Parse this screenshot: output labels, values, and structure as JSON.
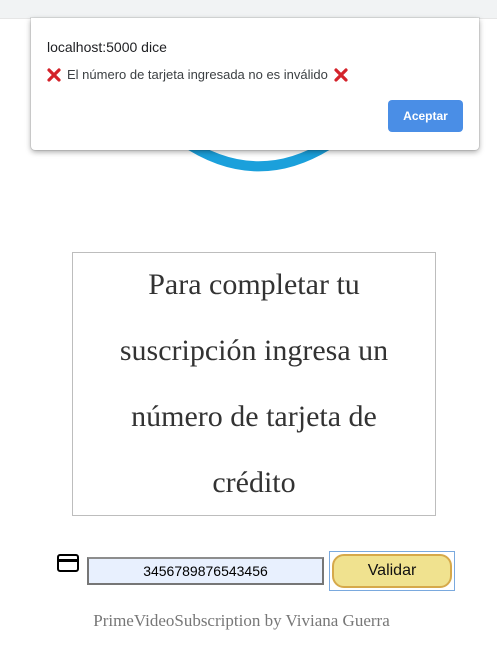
{
  "page": {
    "message": "Para completar tu suscripción ingresa un número de tarjeta de crédito",
    "card_number_value": "3456789876543456",
    "validate_label": "Validar",
    "footer": "PrimeVideoSubscription by Viviana Guerra"
  },
  "dialog": {
    "title": "localhost:5000 dice",
    "message": "El número de tarjeta ingresada no es inválido",
    "ok_label": "Aceptar"
  },
  "icons": {
    "logo": "prime-smile-logo",
    "card": "credit-card-icon",
    "error": "cross-mark-icon"
  },
  "colors": {
    "logo_blue": "#1ba0db",
    "button_yellow": "#f0e28f",
    "button_border": "#d6a94a",
    "input_bg": "#e8f0fe",
    "dialog_button": "#4a8ee6",
    "error_red": "#d4232b"
  }
}
